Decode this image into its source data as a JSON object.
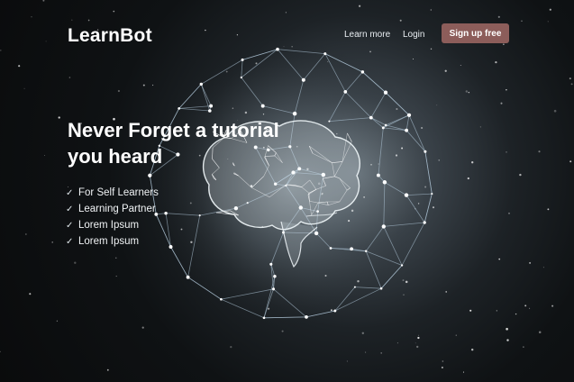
{
  "header": {
    "logo": "LearnBot",
    "nav": {
      "learn_more": "Learn more",
      "login": "Login",
      "signup": "Sign up free"
    }
  },
  "hero": {
    "headline_line1": "Never Forget a tutorial",
    "headline_line2": "you heard",
    "features": [
      "For Self Learners",
      "Learning Partner",
      "Lorem Ipsum",
      "Lorem Ipsum"
    ],
    "check_glyph": "✓",
    "image": "brain-inside-network-sphere"
  },
  "colors": {
    "signup_button": "#8c5d5a",
    "background": "#0f1214",
    "network_lines": "#b9d2e4"
  }
}
